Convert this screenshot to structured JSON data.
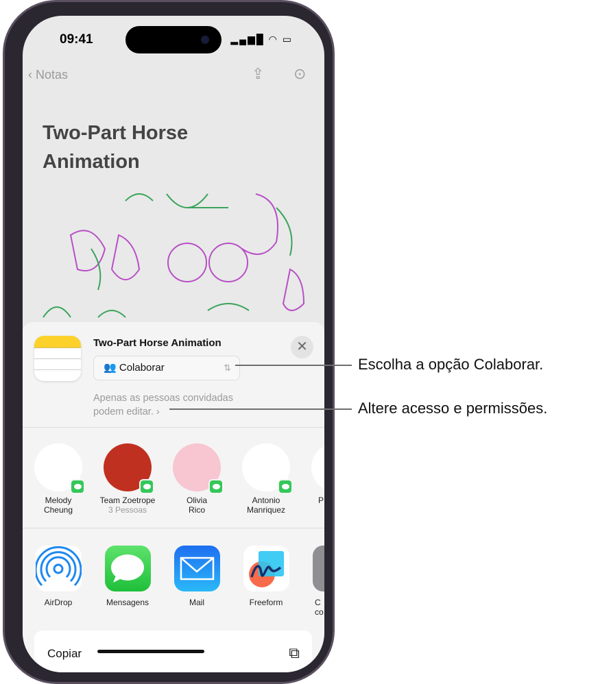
{
  "status_bar": {
    "time": "09:41",
    "icons": [
      "signal-icon",
      "wifi-icon",
      "battery-icon"
    ]
  },
  "nav": {
    "back_label": "Notas",
    "share_icon": "share-icon",
    "more_icon": "ellipsis-circle-icon"
  },
  "note": {
    "title": "Two-Part Horse Animation"
  },
  "sheet": {
    "doc_title": "Two-Part Horse Animation",
    "collab_mode": "Colaborar",
    "access_hint_line1": "Apenas as pessoas convidadas",
    "access_hint_line2": "podem editar.",
    "people": [
      {
        "name1": "Melody",
        "name2": "Cheung",
        "sub": "",
        "bg": "#ffffff"
      },
      {
        "name1": "Team Zoetrope",
        "name2": "",
        "sub": "3 Pessoas",
        "bg": "#c03020"
      },
      {
        "name1": "Olivia",
        "name2": "Rico",
        "sub": "",
        "bg": "#f7c6d0"
      },
      {
        "name1": "Antonio",
        "name2": "Manriquez",
        "sub": "",
        "bg": "#ffffff"
      },
      {
        "name1": "P",
        "name2": "",
        "sub": "",
        "bg": "#ffffff"
      }
    ],
    "apps": [
      {
        "name1": "AirDrop",
        "name2": ""
      },
      {
        "name1": "Mensagens",
        "name2": ""
      },
      {
        "name1": "Mail",
        "name2": ""
      },
      {
        "name1": "Freeform",
        "name2": ""
      },
      {
        "name1": "C",
        "name2": "co"
      }
    ],
    "copy_label": "Copiar"
  },
  "callouts": [
    "Escolha a opção Colaborar.",
    "Altere acesso e permissões."
  ],
  "colors": {
    "messages_green": "#34c759",
    "mail_blue": "#1e88f0",
    "notes_yellow": "#fcd12a"
  }
}
